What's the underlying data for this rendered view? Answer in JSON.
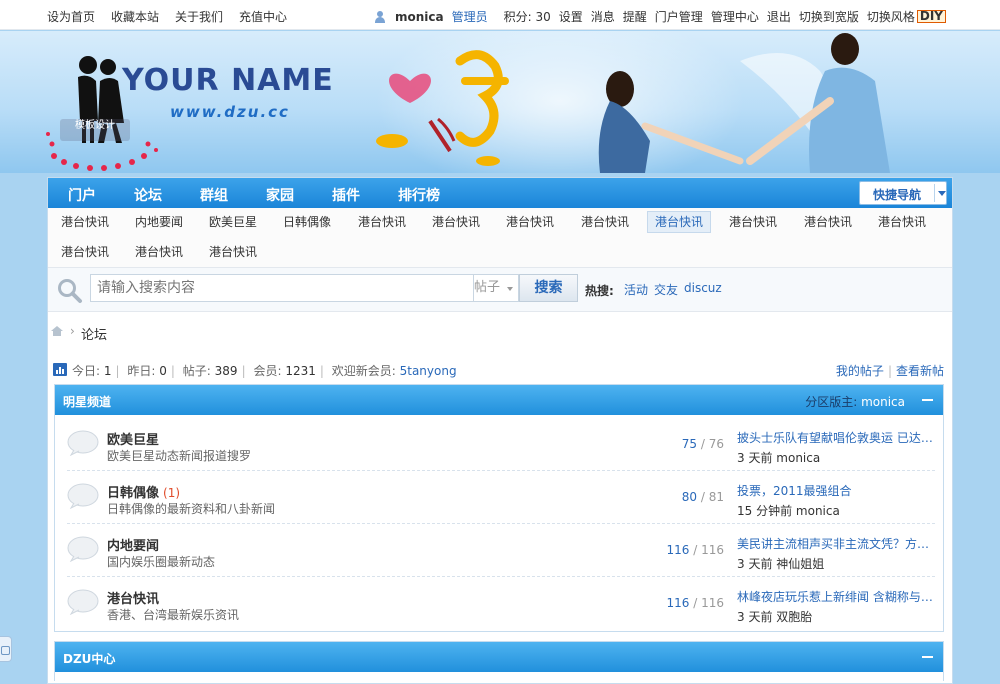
{
  "topbar": {
    "left_links": [
      "设为首页",
      "收藏本站",
      "关于我们",
      "充值中心"
    ],
    "username": "monica",
    "role": "管理员",
    "right_links": [
      "积分: 30",
      "设置",
      "消息",
      "提醒",
      "门户管理",
      "管理中心",
      "退出",
      "切换到宽版",
      "切换风格"
    ],
    "diy_badge": "DIY"
  },
  "banner": {
    "logo_text": "YOUR NAME",
    "logo_url": "www.dzu.cc",
    "logo_badge": "模板设计"
  },
  "nav": {
    "tabs": [
      "门户",
      "论坛",
      "群组",
      "家园",
      "插件",
      "排行榜"
    ],
    "active": "论坛",
    "quick_nav": "快捷导航"
  },
  "subnav": {
    "items": [
      "港台快讯",
      "内地要闻",
      "欧美巨星",
      "日韩偶像",
      "港台快讯",
      "港台快讯",
      "港台快讯",
      "港台快讯",
      "港台快讯",
      "港台快讯",
      "港台快讯",
      "港台快讯",
      "港台快讯",
      "港台快讯",
      "港台快讯"
    ],
    "active_index": 8
  },
  "search": {
    "placeholder": "请输入搜索内容",
    "type": "帖子",
    "button": "搜索",
    "hot_label": "热搜:",
    "hot_links": [
      "活动",
      "交友",
      "discuz"
    ]
  },
  "breadcrumb": {
    "current": "论坛"
  },
  "stats": {
    "today_label": "今日:",
    "today": "1",
    "yesterday_label": "昨日:",
    "yesterday": "0",
    "threads_label": "帖子:",
    "threads": "389",
    "members_label": "会员:",
    "members": "1231",
    "welcome_label": "欢迎新会员:",
    "new_member": "5tanyong",
    "my_posts": "我的帖子",
    "view_new": "查看新帖"
  },
  "blocks": [
    {
      "title": "明星频道",
      "moderator_label": "分区版主:",
      "moderator": "monica",
      "forums": [
        {
          "name": "欧美巨星",
          "today": "",
          "desc": "欧美巨星动态新闻报道搜罗",
          "threads": "75",
          "posts": "76",
          "last_title": "披头士乐队有望献唱伦敦奥运 已达…",
          "last_time": "3 天前",
          "last_user": "monica"
        },
        {
          "name": "日韩偶像",
          "today": "(1)",
          "desc": "日韩偶像的最新资料和八卦新闻",
          "threads": "80",
          "posts": "81",
          "last_title": "投票，2011最强组合",
          "last_time": "15 分钟前",
          "last_user": "monica"
        },
        {
          "name": "内地要闻",
          "today": "",
          "desc": "国内娱乐圈最新动态",
          "threads": "116",
          "posts": "116",
          "last_title": "美民讲主流相声买非主流文凭？方…",
          "last_time": "3 天前",
          "last_user": "神仙姐姐"
        },
        {
          "name": "港台快讯",
          "today": "",
          "desc": "香港、台湾最新娱乐资讯",
          "threads": "116",
          "posts": "116",
          "last_title": "林峰夜店玩乐惹上新绯闻 含糊称与…",
          "last_time": "3 天前",
          "last_user": "双胞胎"
        }
      ]
    },
    {
      "title": "DZU中心"
    }
  ],
  "colors": {
    "nav_blue": "#1a85d8",
    "link_blue": "#2a69b9",
    "page_bg": "#a9d3f1",
    "today_red": "#e04b2a"
  }
}
